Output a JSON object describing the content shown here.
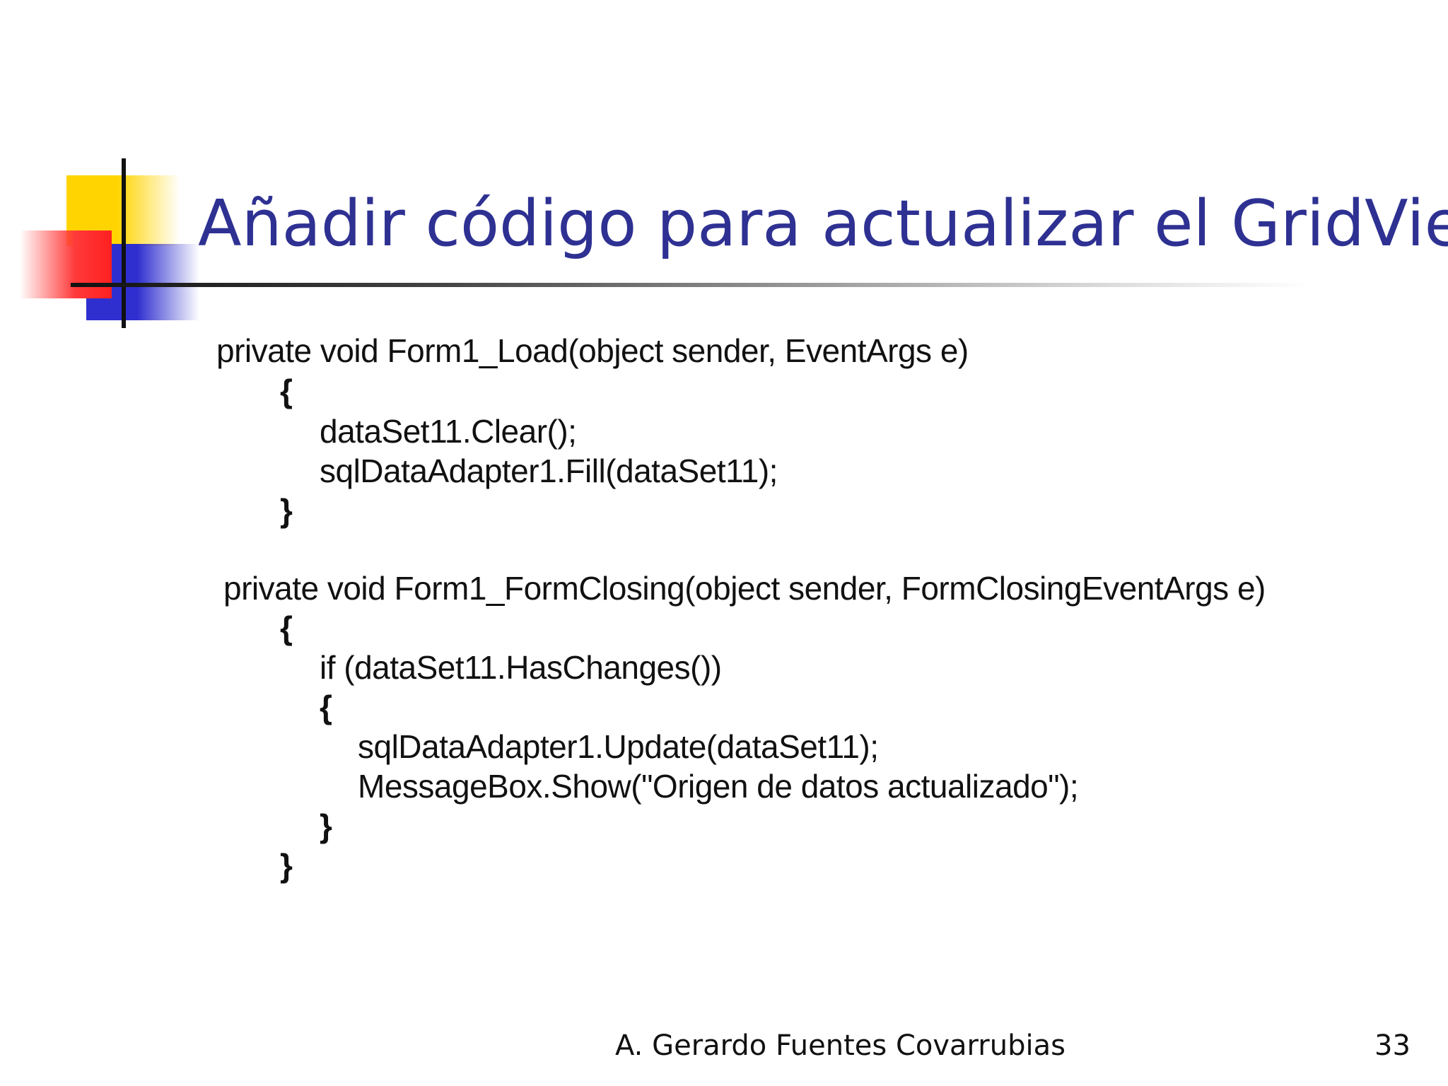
{
  "slide": {
    "title": "Añadir código para actualizar el GridView",
    "code_lines": [
      "private void Form1_Load(object sender, EventArgs e)",
      "{",
      "dataSet11.Clear();",
      "sqlDataAdapter1.Fill(dataSet11);",
      "}",
      "private void Form1_FormClosing(object sender, FormClosingEventArgs e)",
      "{",
      "if (dataSet11.HasChanges())",
      "{",
      "sqlDataAdapter1.Update(dataSet11);",
      "MessageBox.Show(\"Origen de datos actualizado\");",
      "}",
      "}"
    ],
    "footer": {
      "author": "A. Gerardo Fuentes Covarrubias",
      "page_number": "33"
    },
    "colors": {
      "title": "#2e3192",
      "accent_yellow": "#ffd400",
      "accent_red": "#ff2020",
      "accent_blue": "#2f2fd0"
    }
  }
}
